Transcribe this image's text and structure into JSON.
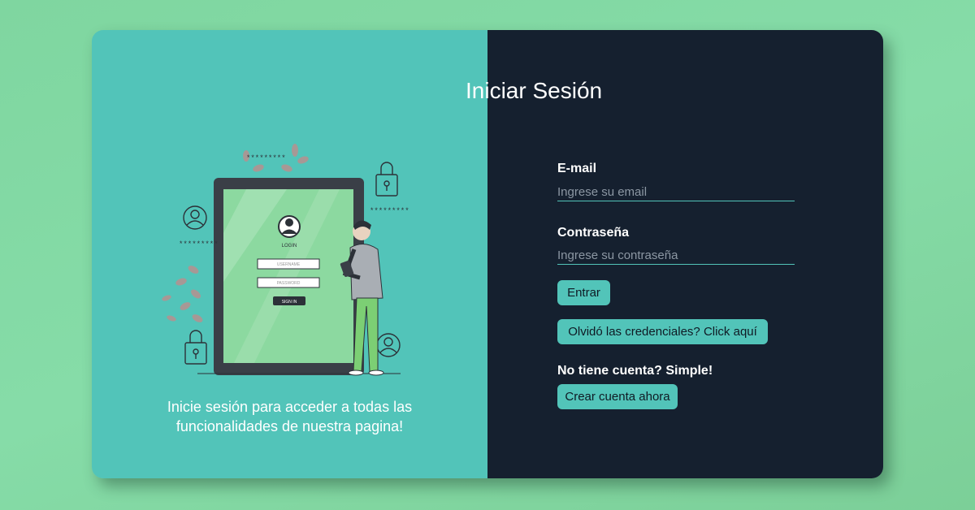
{
  "left_panel": {
    "caption_line1": "Inicie sesión para acceder a todas las",
    "caption_line2": "funcionalidades de nuestra pagina!",
    "illustration": {
      "login_heading": "LOGIN",
      "username_placeholder": "USERNAME",
      "password_placeholder": "PASSWORD",
      "sign_in_label": "SIGN IN",
      "stars_left": "*********",
      "stars_top": "*********",
      "stars_right": "*********"
    }
  },
  "login_form": {
    "title": "Iniciar Sesión",
    "email_label": "E-mail",
    "email_placeholder": "Ingrese su email",
    "password_label": "Contraseña",
    "password_placeholder": "Ingrese su contraseña",
    "submit_label": "Entrar",
    "forgot_label": "Olvidó las credenciales? Click aquí",
    "no_account_text": "No tiene cuenta? Simple!",
    "create_account_label": "Crear cuenta ahora"
  },
  "colors": {
    "accent": "#52c4b9",
    "dark_panel": "#15202f",
    "background": "#86dca8"
  }
}
